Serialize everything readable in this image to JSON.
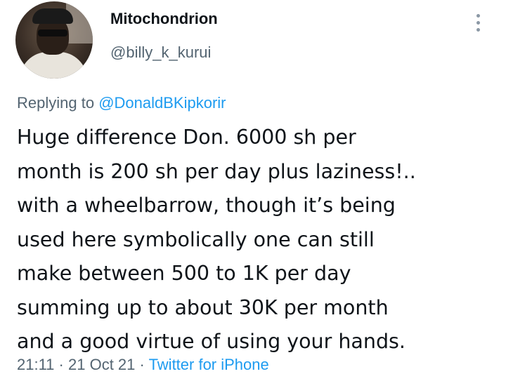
{
  "author": {
    "display_name": "Mitochondrion",
    "handle": "@billy_k_kurui"
  },
  "more_icon": "more-vertical-icon",
  "reply": {
    "prefix": "Replying to",
    "mention": "@DonaldBKipkorir"
  },
  "tweet": {
    "text": "Huge difference Don. 6000 sh per\nmonth is 200 sh per day plus laziness!..\nwith a wheelbarrow, though it’s being\nused here symbolically one can still\nmake between 500 to 1K per day\nsumming up to about 30K per month\nand a good virtue of using your hands."
  },
  "meta": {
    "time": "21:11",
    "separator": "·",
    "date": "21 Oct 21",
    "source": "Twitter for iPhone"
  },
  "colors": {
    "text": "#0f1419",
    "secondary": "#536471",
    "link": "#1d9bf0"
  }
}
